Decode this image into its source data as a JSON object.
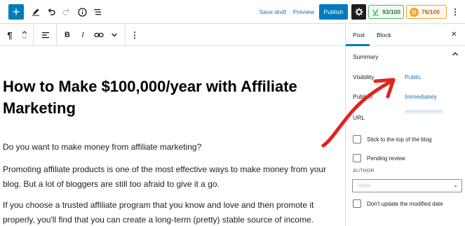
{
  "topbar": {
    "add_icon": "plus-icon",
    "tools_icon": "pencil-icon",
    "undo_icon": "undo-icon",
    "redo_icon": "redo-icon",
    "info_icon": "info-icon",
    "outline_icon": "list-view-icon",
    "save_draft": "Save draft",
    "preview": "Preview",
    "publish": "Publish",
    "settings_icon": "gear-icon",
    "seo_score": "93/100",
    "readability_score": "76/100",
    "more_icon": "vertical-ellipsis-icon",
    "seo_color": "#4ab866",
    "readability_color": "#f0a430",
    "accent_color": "#007cba"
  },
  "block_toolbar": {
    "paragraph_icon": "pilcrow-icon",
    "move_icon": "chevron-up-down-icon",
    "align_icon": "align-left-icon",
    "bold_label": "B",
    "italic_label": "I",
    "link_icon": "link-icon",
    "more_format_icon": "chevron-down-icon",
    "options_icon": "vertical-ellipsis-icon"
  },
  "editor": {
    "title": "How to Make $100,000/year with Affiliate Marketing",
    "paragraphs": [
      "Do you want to make money from affiliate marketing?",
      "Promoting affiliate products is one of the most effective ways to make money from your blog. But a lot of bloggers are still too afraid to give it a go.",
      "If you choose a trusted affiliate program that you know and love and then promote it properly, you'll find that you can create a long-term (pretty) stable source of income."
    ]
  },
  "sidebar": {
    "tab_post": "Post",
    "tab_block": "Block",
    "close_icon": "close-icon",
    "summary_title": "Summary",
    "summary_chevron": "chevron-up-icon",
    "visibility_label": "Visibility",
    "visibility_value": "Public",
    "publish_label": "Publish",
    "publish_value": "Immediately",
    "url_label": "URL",
    "url_value": "••••••••••••••••••••••",
    "sticky_label": "Stick to the top of the blog",
    "pending_label": "Pending review",
    "author_label": "AUTHOR",
    "author_value": "••••••",
    "modified_label": "Don't update the modified date"
  }
}
